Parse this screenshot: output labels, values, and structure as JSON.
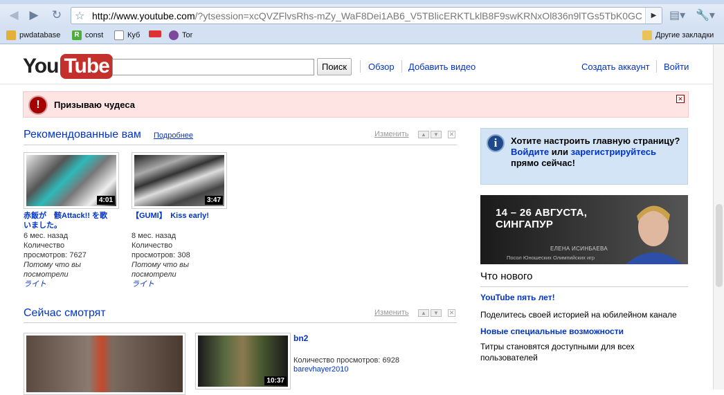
{
  "browser": {
    "url_host": "http://www.youtube.com",
    "url_rest": "/?ytsession=xcQVZFlvsRhs-mZy_WaF8Dei1AB6_V5TBlicERKTLklB8F9swKRNxOl836n9lTGs5TbK0GC",
    "icons": {
      "back": "back-arrow-icon",
      "forward": "forward-arrow-icon",
      "reload": "reload-icon",
      "star": "bookmark-star-icon",
      "go": "go-arrow-icon",
      "page": "page-menu-icon",
      "wrench": "wrench-icon"
    },
    "bookmarks": [
      "pwdatabase",
      "const",
      "Куб",
      "Tor"
    ],
    "other_bookmarks": "Другие закладки"
  },
  "header": {
    "logo_you": "You",
    "logo_tube": "Tube",
    "search_value": "",
    "search_button": "Поиск",
    "browse": "Обзор",
    "upload": "Добавить видео",
    "create_account": "Создать аккаунт",
    "login": "Войти"
  },
  "alert": {
    "text": "Призываю чудеса",
    "icon": "!"
  },
  "recommended": {
    "title": "Рекомендованные вам",
    "more": "Подробнее",
    "edit": "Изменить",
    "videos": [
      {
        "title": "赤飯が　骸Attack!! を歌いました。",
        "duration": "4:01",
        "age": "6 мес. назад",
        "views_label": "Количество просмотров: 7627",
        "reason": "Потому что вы посмотрели",
        "source": "ライト"
      },
      {
        "title": "【GUMI】　Kiss early!",
        "duration": "3:47",
        "age": "8 мес. назад",
        "views_label": "Количество просмотров: 308",
        "reason": "Потому что вы посмотрели",
        "source": "ライト"
      }
    ]
  },
  "watching_now": {
    "title": "Сейчас смотрят",
    "edit": "Изменить",
    "video": {
      "title": "bn2",
      "duration": "10:37",
      "views_label": "Количество просмотров: 6928",
      "user": "barevhayer2010"
    }
  },
  "sidebar": {
    "info_line1": "Хотите настроить главную страницу?",
    "info_login": "Войдите",
    "info_or": "или",
    "info_register": "зарегистрируйтесь",
    "info_end": "прямо сейчас!",
    "banner_dates": "14 – 26 АВГУСТА,",
    "banner_city": "СИНГАПУР",
    "banner_name": "ЕЛЕНА ИСИНБАЕВА",
    "banner_sub": "Посол Юношеских Олимпийских игр",
    "whatsnew_title": "Что нового",
    "news": [
      {
        "link": "YouTube пять лет!",
        "text": "Поделитесь своей историей на юбилейном канале"
      },
      {
        "link": "Новые специальные возможности",
        "text": "Титры становятся доступными для всех пользователей"
      }
    ]
  }
}
